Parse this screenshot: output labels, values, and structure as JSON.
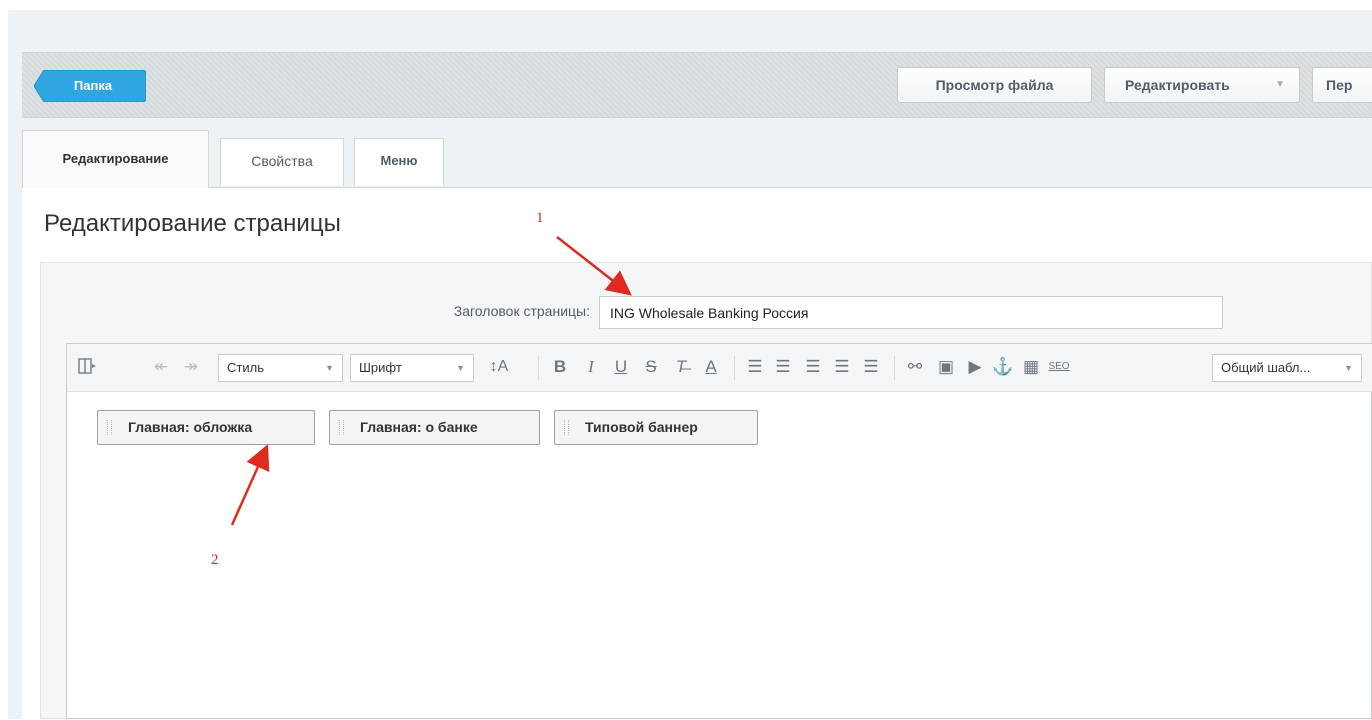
{
  "toolbar": {
    "folder_label": "Папка",
    "view_file_label": "Просмотр файла",
    "edit_label": "Редактировать",
    "more_label": "Пер"
  },
  "tabs": [
    {
      "label": "Редактирование"
    },
    {
      "label": "Свойства"
    },
    {
      "label": "Меню"
    }
  ],
  "page": {
    "title": "Редактирование страницы"
  },
  "form": {
    "page_title_label": "Заголовок страницы:",
    "page_title_value": "ING Wholesale Banking Россия"
  },
  "editor": {
    "style_dropdown": "Стиль",
    "font_dropdown": "Шрифт",
    "template_dropdown": "Общий шабл...",
    "seo_label": "SEO",
    "blocks": [
      {
        "label": "Главная: обложка"
      },
      {
        "label": "Главная: о банке"
      },
      {
        "label": "Типовой баннер"
      }
    ]
  },
  "annotations": {
    "marker_1": "1",
    "marker_2": "2"
  },
  "colors": {
    "folder_button": "#2fa6e0",
    "annotation": "#cc2a1f"
  }
}
